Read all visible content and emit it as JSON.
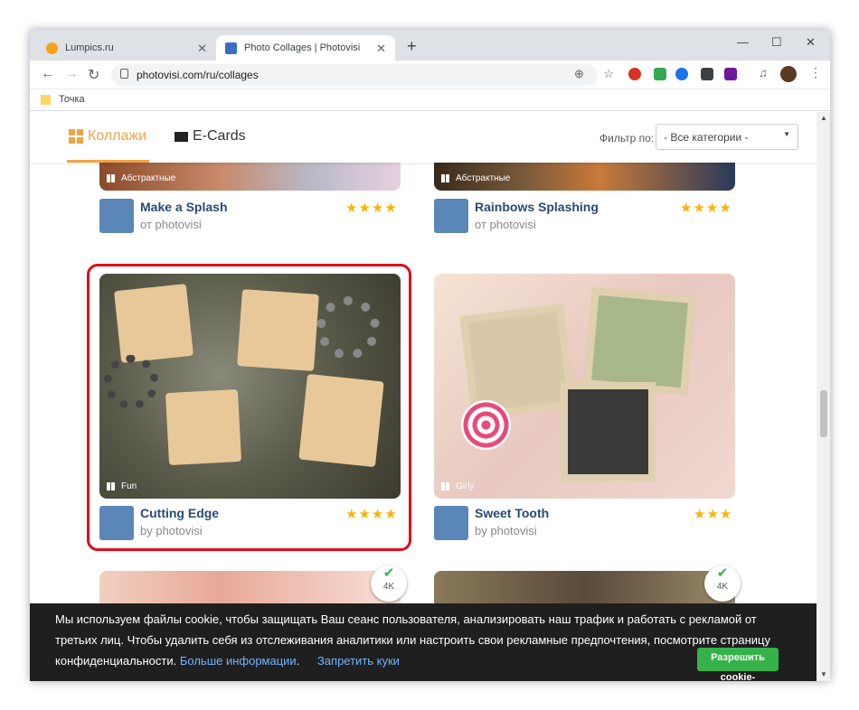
{
  "browser": {
    "tabs": [
      {
        "title": "Lumpics.ru",
        "close": "✕"
      },
      {
        "title": "Photo Collages | Photovisi",
        "close": "✕"
      }
    ],
    "new_tab": "+",
    "window_controls": {
      "minimize": "—",
      "maximize": "☐",
      "close": "✕"
    },
    "url": "photovisi.com/ru/collages",
    "bookmark": "Точка"
  },
  "site": {
    "nav": {
      "collages": "Коллажи",
      "ecards": "E-Cards"
    },
    "filter_label": "Фильтр по:",
    "filter_value": "- Все категории -",
    "colors": {
      "accent": "#f0a445",
      "title": "#2a4a73",
      "stars": "#f5b50a",
      "allow": "#35b34a",
      "highlight": "#e10b1b"
    }
  },
  "cards": [
    {
      "tag": "Абстрактные",
      "title": "Make a Splash",
      "author": "от photovisi",
      "stars": "★★★★",
      "rating": 4
    },
    {
      "tag": "Абстрактные",
      "title": "Rainbows Splashing",
      "author": "от photovisi",
      "stars": "★★★★",
      "rating": 4
    },
    {
      "tag": "Fun",
      "title": "Cutting Edge",
      "author": "by photovisi",
      "stars": "★★★★",
      "rating": 4
    },
    {
      "tag": "Girly",
      "title": "Sweet Tooth",
      "author": "by photovisi",
      "stars": "★★★",
      "rating": 3
    }
  ],
  "badges": [
    {
      "label": "4K"
    },
    {
      "label": "4K"
    }
  ],
  "cookie": {
    "text": "Мы используем файлы cookie, чтобы защищать Ваш сеанс пользователя, анализировать наш трафик и работать с рекламой от третьих лиц. Чтобы удалить себя из отслеживания аналитики или настроить свои рекламные предпочтения, посмотрите страницу конфиденциальности.",
    "more_info": "Больше информации",
    "deny": "Запретить куки",
    "allow": "Разрешить cookie-"
  }
}
